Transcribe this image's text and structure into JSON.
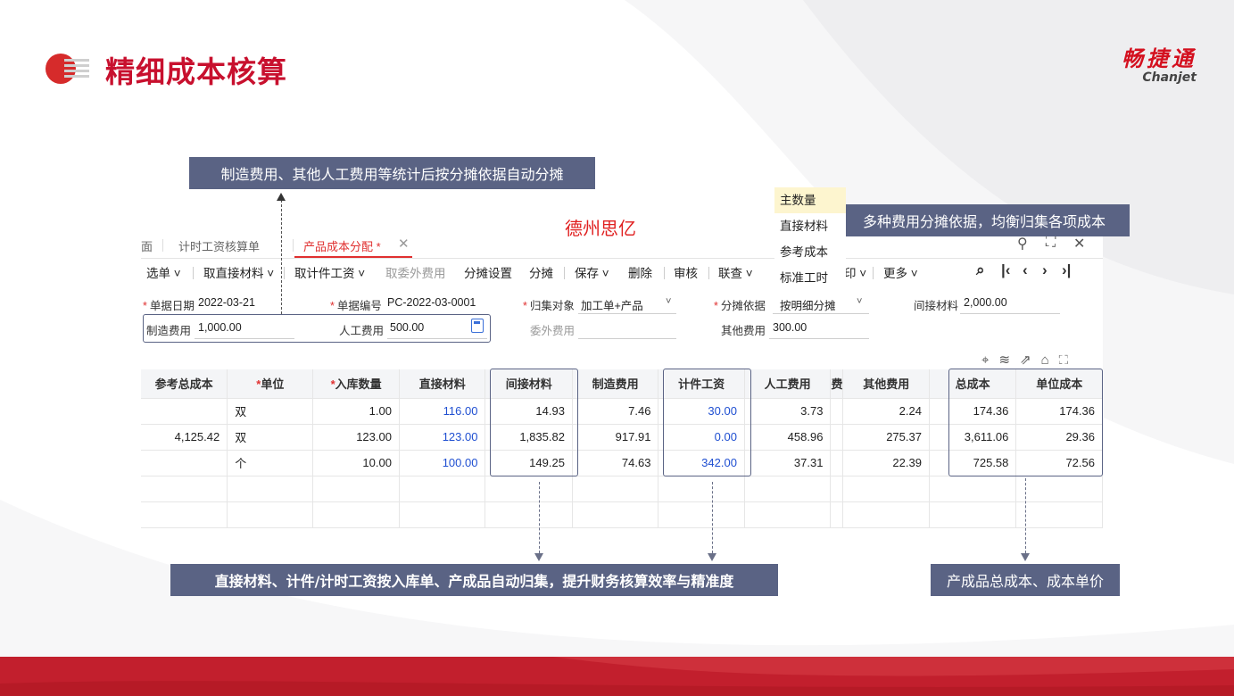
{
  "slide": {
    "title": "精细成本核算",
    "brand_cn": "畅捷通",
    "brand_en": "Chanjet",
    "watermark": "德州思亿",
    "callouts": {
      "top_left": "制造费用、其他人工费用等统计后按分摊依据自动分摊",
      "top_right": "多种费用分摊依据，均衡归集各项成本",
      "bottom_left": "直接材料、计件/计时工资按入库单、产成品自动归集，提升财务核算效率与精准度",
      "bottom_right": "产成品总成本、成本单价"
    }
  },
  "tabs": {
    "partial": "面",
    "items": [
      "计时工资核算单",
      "产品成本分配 *"
    ]
  },
  "toolbar": {
    "items": [
      "选单",
      "取直接材料",
      "取计件工资",
      "取委外费用",
      "分摊设置",
      "分摊",
      "保存",
      "删除",
      "审核",
      "联查",
      "印",
      "更多"
    ]
  },
  "dropdown": {
    "options": [
      "主数量",
      "直接材料",
      "参考成本",
      "标准工时"
    ],
    "selected": "主数量"
  },
  "form": {
    "date_label": "单据日期",
    "date_value": "2022-03-21",
    "no_label": "单据编号",
    "no_value": "PC-2022-03-0001",
    "object_label": "归集对象",
    "object_value": "加工单+产品",
    "basis_label": "分摊依据",
    "basis_value": "按明细分摊",
    "indirect_label": "间接材料",
    "indirect_value": "2,000.00",
    "mfg_label": "制造费用",
    "mfg_value": "1,000.00",
    "labor_label": "人工费用",
    "labor_value": "500.00",
    "outsource_label": "委外费用",
    "outsource_value": "",
    "other_label": "其他费用",
    "other_value": "300.00"
  },
  "table": {
    "headers": [
      "参考总成本",
      "单位",
      "入库数量",
      "直接材料",
      "间接材料",
      "制造费用",
      "计件工资",
      "人工费用",
      "费",
      "其他费用",
      "总成本",
      "单位成本"
    ],
    "rows": [
      [
        "",
        "双",
        "1.00",
        "116.00",
        "14.93",
        "7.46",
        "30.00",
        "3.73",
        "",
        "2.24",
        "174.36",
        "174.36"
      ],
      [
        "4,125.42",
        "双",
        "123.00",
        "123.00",
        "1,835.82",
        "917.91",
        "0.00",
        "458.96",
        "",
        "275.37",
        "3,611.06",
        "29.36"
      ],
      [
        "",
        "个",
        "10.00",
        "100.00",
        "149.25",
        "74.63",
        "342.00",
        "37.31",
        "",
        "22.39",
        "725.58",
        "72.56"
      ]
    ]
  },
  "colors": {
    "accent": "#c8102e",
    "callout": "#5a6384",
    "link": "#1f4fd1"
  }
}
